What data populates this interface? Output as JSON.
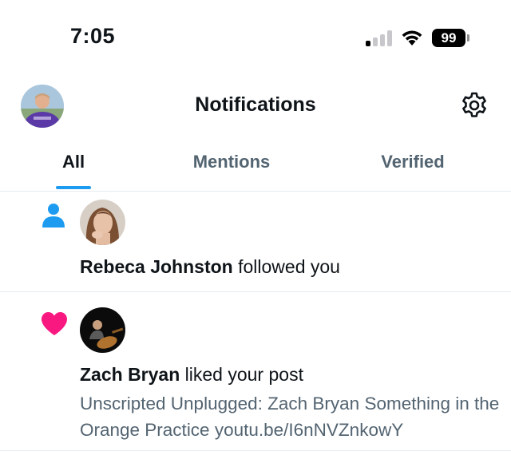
{
  "status_bar": {
    "time": "7:05",
    "battery_level": "99",
    "signal_bars_active": 1,
    "signal_bars_total": 4
  },
  "header": {
    "title": "Notifications",
    "avatar_icon": "user-avatar",
    "settings_icon": "gear-icon"
  },
  "tabs": [
    {
      "label": "All",
      "active": true
    },
    {
      "label": "Mentions",
      "active": false
    },
    {
      "label": "Verified",
      "active": false
    }
  ],
  "notifications": [
    {
      "type_icon": "person-icon",
      "type_color": "#1d9bf0",
      "user": "Rebeca Johnston",
      "action": " followed you"
    },
    {
      "type_icon": "heart-icon",
      "type_color": "#f91880",
      "user": "Zach Bryan",
      "action": " liked your post",
      "preview": "Unscripted Unplugged: Zach Bryan Something in the Orange  Practice youtu.be/I6nNVZnkowY"
    }
  ],
  "colors": {
    "accent": "#1d9bf0",
    "like": "#f91880",
    "secondary_text": "#536471",
    "divider": "#e6ecf0"
  }
}
